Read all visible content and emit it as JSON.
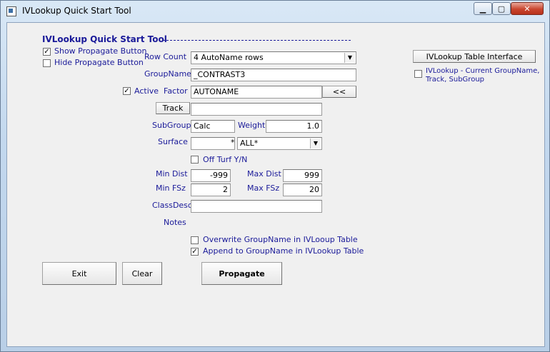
{
  "window": {
    "title": "IVLookup Quick Start Tool",
    "min_glyph": "▁",
    "max_glyph": "▢",
    "close_glyph": "✕"
  },
  "form": {
    "heading": "IVLookup Quick Start Tool",
    "show_propagate": {
      "label": "Show Propagate Button",
      "checked": true
    },
    "hide_propagate": {
      "label": "Hide Propagate Button",
      "checked": false
    },
    "row_count": {
      "label": "Row Count",
      "value": "4 AutoName rows"
    },
    "group_name": {
      "label": "GroupName",
      "value": "_CONTRAST3"
    },
    "active": {
      "label": "Active",
      "checked": true
    },
    "factor": {
      "label": "Factor",
      "value": "AUTONAME",
      "button": "<<"
    },
    "track": {
      "button": "Track",
      "value": ""
    },
    "subgroup": {
      "label": "SubGroup",
      "value": "Calc"
    },
    "weight": {
      "label": "Weight",
      "value": "1.0"
    },
    "surface": {
      "label": "Surface",
      "value": "",
      "star": "*",
      "select_value": "ALL*"
    },
    "off_turf": {
      "label": "Off Turf Y/N",
      "checked": false
    },
    "min_dist": {
      "label": "Min Dist",
      "value": "-999"
    },
    "max_dist": {
      "label": "Max Dist",
      "value": "999"
    },
    "min_fsz": {
      "label": "Min FSz",
      "value": "2"
    },
    "max_fsz": {
      "label": "Max FSz",
      "value": "20"
    },
    "class_descr": {
      "label": "ClassDescr",
      "value": ""
    },
    "notes": {
      "label": "Notes"
    },
    "overwrite": {
      "label": "Overwrite GroupName in IVLooup Table",
      "checked": false
    },
    "append": {
      "label": "Append to GroupName in IVLookup Table",
      "checked": true
    },
    "exit_button": "Exit",
    "clear_button": "Clear",
    "propagate_button": "Propagate",
    "table_interface_button": "IVLookup Table Interface",
    "current_groupname": {
      "line1": "IVLookup - Current GroupName,",
      "line2": "Track, SubGroup",
      "checked": false
    }
  },
  "colors": {
    "label": "#1a1a99",
    "heading": "#1a1a99",
    "client_bg": "#f0f0f0"
  }
}
